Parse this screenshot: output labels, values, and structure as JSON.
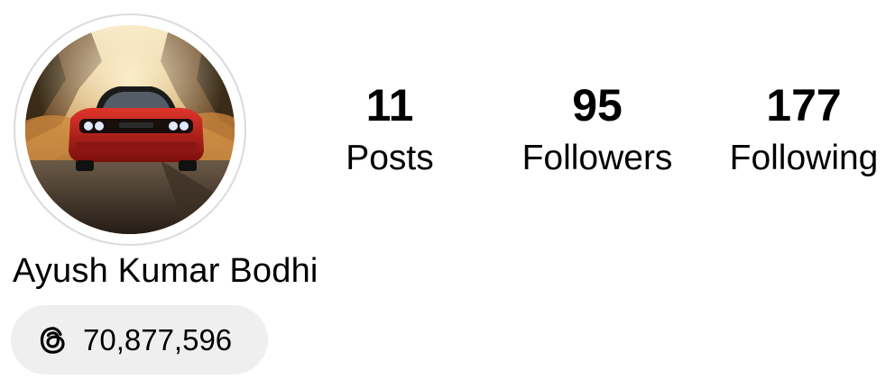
{
  "profile": {
    "name": "Ayush Kumar Bodhi",
    "avatar_icon": "profile-photo-red-car"
  },
  "stats": {
    "posts": {
      "count": "11",
      "label": "Posts"
    },
    "followers": {
      "count": "95",
      "label": "Followers"
    },
    "following": {
      "count": "177",
      "label": "Following"
    }
  },
  "threads": {
    "icon": "threads-icon",
    "count": "70,877,596"
  },
  "colors": {
    "badge_background": "#efefef",
    "ring_border": "#dbdbdb",
    "text": "#000000"
  }
}
